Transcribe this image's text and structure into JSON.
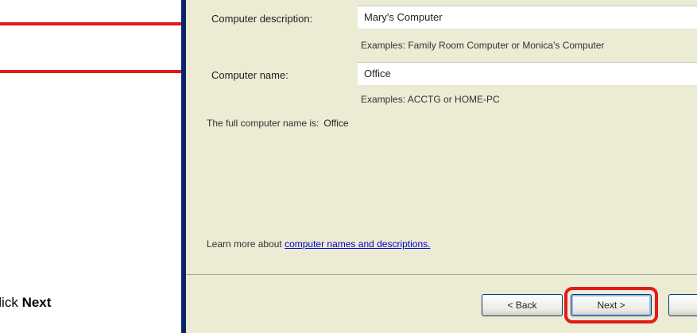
{
  "instruction": {
    "prefix": "Click ",
    "emphasis": "Next"
  },
  "form": {
    "description_label": "Computer description:",
    "description_value": "Mary's Computer",
    "description_hint": "Examples: Family Room Computer or Monica's Computer",
    "name_label": "Computer name:",
    "name_value": "Office",
    "name_hint": "Examples: ACCTG or HOME-PC",
    "full_name_label": "The full computer name is:",
    "full_name_value": "Office"
  },
  "learn_more": {
    "prefix": "Learn more about ",
    "link": "computer names and descriptions."
  },
  "buttons": {
    "back": "< Back",
    "next": "Next >"
  },
  "colors": {
    "arrow": "#e01b1b",
    "panel": "#ecebd3",
    "window_border": "#0a246a",
    "highlight": "#e01b1b"
  },
  "icons": [
    "right-arrow-icon"
  ]
}
